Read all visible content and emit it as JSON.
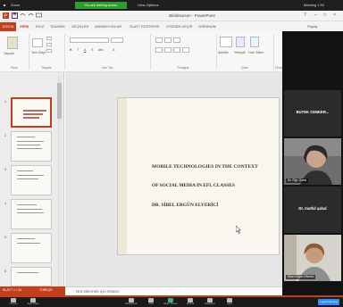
{
  "zoom_top": {
    "left_label": "Zoom",
    "green_banner": "You are viewing screen",
    "view_label": "View Options",
    "right_label": "Meeting 1:52"
  },
  "ppt": {
    "window_title": "Bildirisunum - PowerPoint",
    "window_controls": [
      "?",
      "–",
      "□",
      "×"
    ],
    "share_label": "Paylaş"
  },
  "ribbon_tabs": [
    "DOSYA",
    "GİRİŞ",
    "EKLE",
    "TASARIM",
    "GEÇİŞLER",
    "ANİMASYONLAR",
    "SLAYT GÖSTERİSİ",
    "GÖZDEN GEÇİR",
    "GÖRÜNÜM"
  ],
  "ribbon": {
    "groups": [
      "Pano",
      "Slaytlar",
      "Yazı Tipi",
      "Paragraf",
      "Çizim",
      "Düzen"
    ],
    "paste_label": "Yapıştır",
    "new_slide_label": "Yeni Slayt",
    "shapes_label": "Şekiller",
    "arrange_label": "Yerleştir",
    "quick_styles_label": "Hızlı Stiller"
  },
  "thumbnails": [
    {
      "num": "1",
      "active": true
    },
    {
      "num": "2",
      "active": false
    },
    {
      "num": "3",
      "active": false
    },
    {
      "num": "4",
      "active": false
    },
    {
      "num": "5",
      "active": false
    },
    {
      "num": "6",
      "active": false
    }
  ],
  "slide": {
    "line1": "MOBILE TECHNOLOGIES IN THE CONTEXT",
    "line2": "OF SOCIAL MEDIA IN EFL CLASSES",
    "author": "DR. SİBEL ERGÜN ELVERİCİ"
  },
  "notes_placeholder": "Not eklemek için tıklatın",
  "status": {
    "slide_counter": "SLAYT 1 / 23",
    "lang": "TÜRKÇE"
  },
  "participants": [
    {
      "type": "name",
      "name": "BUTEK CENKER..."
    },
    {
      "type": "video",
      "name": "Dr. Öğr. Üyesi"
    },
    {
      "type": "name",
      "name": "Dr. mutlul şahal"
    },
    {
      "type": "video",
      "name": "Sibel Ergün Elverici"
    }
  ],
  "zoom_bottom": {
    "buttons": [
      "Unmute",
      "Start Video",
      "Participants",
      "Chat",
      "Share Screen",
      "Record",
      "Reactions",
      "Apps"
    ],
    "end_label": "Leave Meeting"
  },
  "colors": {
    "accent": "#c43e1c",
    "zoom_dark": "#1f1f1f",
    "zoom_blue": "#2d8cff"
  }
}
